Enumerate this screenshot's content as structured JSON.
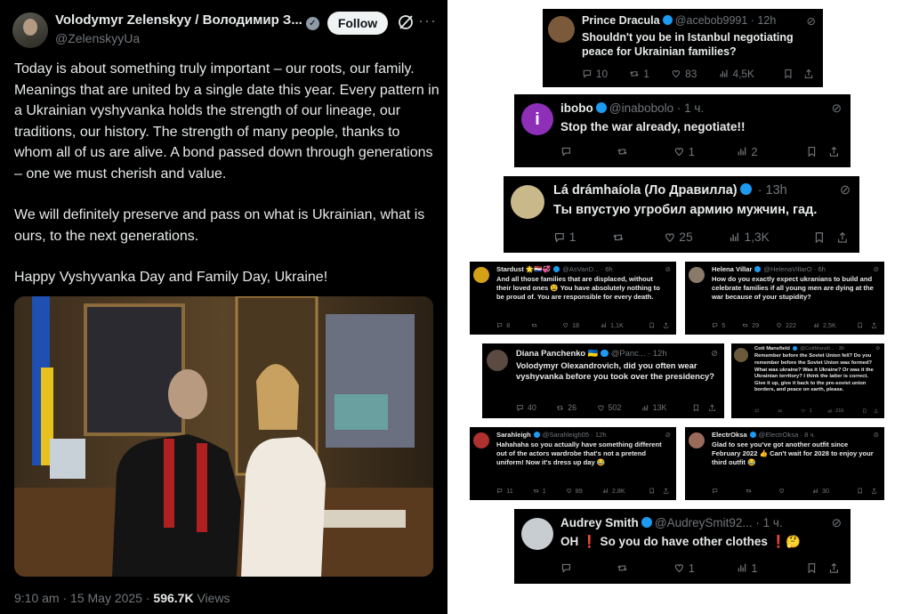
{
  "main_tweet": {
    "author_name": "Volodymyr Zelenskyy / Володимир З...",
    "author_handle": "@ZelenskyyUa",
    "follow_label": "Follow",
    "paragraphs": [
      "Today is about something truly important – our roots, our family. Meanings that are united by a single date this year. Every pattern in a Ukrainian vyshyvanka holds the strength of our lineage, our traditions, our history. The strength of many people, thanks to whom all of us are alive. A bond passed down through generations – one we must cherish and value.",
      "We will definitely preserve and pass on what is Ukrainian, what is ours, to the next generations.",
      "Happy Vyshyvanka Day and Family Day, Ukraine!"
    ],
    "timestamp": "9:10 am · 15 May 2025 · ",
    "views_count": "596.7K",
    "views_label": " Views"
  },
  "replies": [
    {
      "name": "Prince Dracula",
      "handle": "@acebob9991 · 12h",
      "text": "Shouldn't you be in Istanbul negotiating peace for Ukrainian families?",
      "stats": [
        "10",
        "1",
        "83",
        "4,5K"
      ],
      "avatar": "#7a5a3a"
    },
    {
      "name": "ibobo",
      "handle": "@inabobolo · 1 ч.",
      "text": "Stop the war already, negotiate!!",
      "stats": [
        "",
        "",
        "1",
        "2"
      ],
      "avatar": "#8e2fb8",
      "avatar_letter": "i"
    },
    {
      "name": "Lá drámhaíola (Ло Дравилла)",
      "handle": " · 13h",
      "text": "Ты впустую угробил армию мужчин, гад.",
      "stats": [
        "1",
        "",
        "25",
        "1,3K"
      ],
      "avatar": "#c9b98a"
    },
    {
      "name": "Stardust 🌟🇳🇱💞",
      "handle": "@AsVanD... · 6h",
      "text": "And all those families that are displaced, without their loved ones 😩 You have absolutely nothing to be proud of. You are responsible for every death.",
      "stats": [
        "8",
        "",
        "18",
        "1,1K"
      ],
      "avatar": "#d4a017"
    },
    {
      "name": "Helena Villar",
      "handle": "@HelenaVillarO · 6h",
      "text": "How do you exactly expect ukranians to build and celebrate families if all young men are dying at the war because of your stupidity?",
      "stats": [
        "5",
        "29",
        "222",
        "2,5K"
      ],
      "avatar": "#8a7a6a"
    },
    {
      "name": "Diana Panchenko 🇺🇦",
      "handle": "@Panc... · 12h",
      "text": "Volodymyr Olexandrovich, did you often wear vyshyvanka before you took over the presidency?",
      "stats": [
        "40",
        "26",
        "502",
        "13K"
      ],
      "avatar": "#5a4a42"
    },
    {
      "name": "Cott Mansfield",
      "handle": "@CottMansfi... · 3h",
      "text": "Remember before the Soviet Union fell? Do you remember before the Soviet Union was formed? What was ukraine? Was it Ukraine? Or was it the Ukrainian territory? I think the latter is correct. Give it up, give it back to the pre-soviet union borders, and peace on earth, please.",
      "stats": [
        "",
        "",
        "1",
        "216"
      ],
      "avatar": "#6a5a3a"
    },
    {
      "name": "Sarahleigh",
      "handle": "@Sarahleigh05 · 12h",
      "text": "Hahahaha so you actually have something different out of the actors wardrobe that's not a pretend uniform! Now it's dress up day 😂",
      "stats": [
        "11",
        "1",
        "89",
        "2,8K"
      ],
      "avatar": "#b03030"
    },
    {
      "name": "ElectrOksa",
      "handle": "@ElectrOksa · 8 ч.",
      "text": "Glad to see you've got another outfit since February 2022 👍 Can't wait for 2028 to enjoy your third outfit 😂",
      "stats": [
        "",
        "",
        "",
        "30"
      ],
      "avatar": "#9a6a5a"
    },
    {
      "name": "Audrey Smith",
      "handle": "@AudreySmit92... · 1 ч.",
      "text": "OH ❗ So you do have other clothes ❗🤔",
      "stats": [
        "",
        "",
        "1",
        "1"
      ],
      "avatar": "#c8cdd2"
    }
  ]
}
